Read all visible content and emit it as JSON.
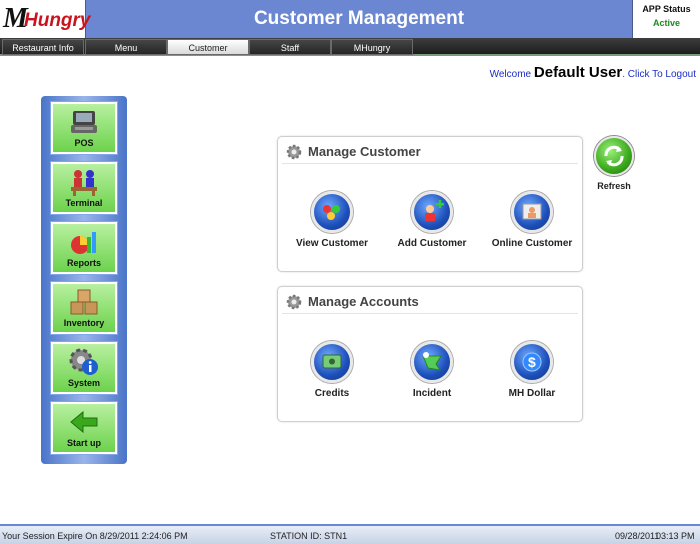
{
  "app": {
    "logo_m": "M",
    "logo_hungry": "Hungry",
    "title": "Customer Management",
    "status_label": "APP Status",
    "status_value": "Active"
  },
  "nav": {
    "tabs": [
      {
        "label": "Restaurant Info",
        "active": false
      },
      {
        "label": "Menu",
        "active": false
      },
      {
        "label": "Customer",
        "active": true
      },
      {
        "label": "Staff",
        "active": false
      },
      {
        "label": "MHungry",
        "active": false
      }
    ]
  },
  "welcome": {
    "prefix": "Welcome",
    "user": "Default User",
    "logout": ". Click To Logout"
  },
  "sidebar": {
    "items": [
      {
        "label": "POS",
        "icon": "pos-terminal-icon"
      },
      {
        "label": "Terminal",
        "icon": "terminal-people-icon"
      },
      {
        "label": "Reports",
        "icon": "reports-chart-icon"
      },
      {
        "label": "Inventory",
        "icon": "inventory-boxes-icon"
      },
      {
        "label": "System",
        "icon": "system-gear-info-icon"
      },
      {
        "label": "Start up",
        "icon": "start-up-arrow-icon"
      }
    ]
  },
  "manage_customer": {
    "title": "Manage Customer",
    "actions": [
      {
        "label": "View Customer",
        "icon": "view-customer-icon"
      },
      {
        "label": "Add Customer",
        "icon": "add-customer-icon"
      },
      {
        "label": "Online Customer",
        "icon": "online-customer-icon"
      }
    ]
  },
  "manage_accounts": {
    "title": "Manage Accounts",
    "actions": [
      {
        "label": "Credits",
        "icon": "credits-icon"
      },
      {
        "label": "Incident",
        "icon": "incident-icon"
      },
      {
        "label": "MH Dollar",
        "icon": "mh-dollar-icon"
      }
    ]
  },
  "refresh": {
    "label": "Refresh",
    "icon": "refresh-icon"
  },
  "footer": {
    "session": "Your Session Expire On 8/29/2011 2:24:06 PM",
    "station": "STATION ID: STN1",
    "date": "09/28/2011",
    "time": "03:13 PM"
  },
  "colors": {
    "header_blue": "#6c87d2",
    "side_green": "#6cd24c",
    "action_blue": "#1d4fba",
    "refresh_green": "#3aa81c",
    "logo_red": "#c8141e",
    "status_green": "#1a8a1a"
  }
}
